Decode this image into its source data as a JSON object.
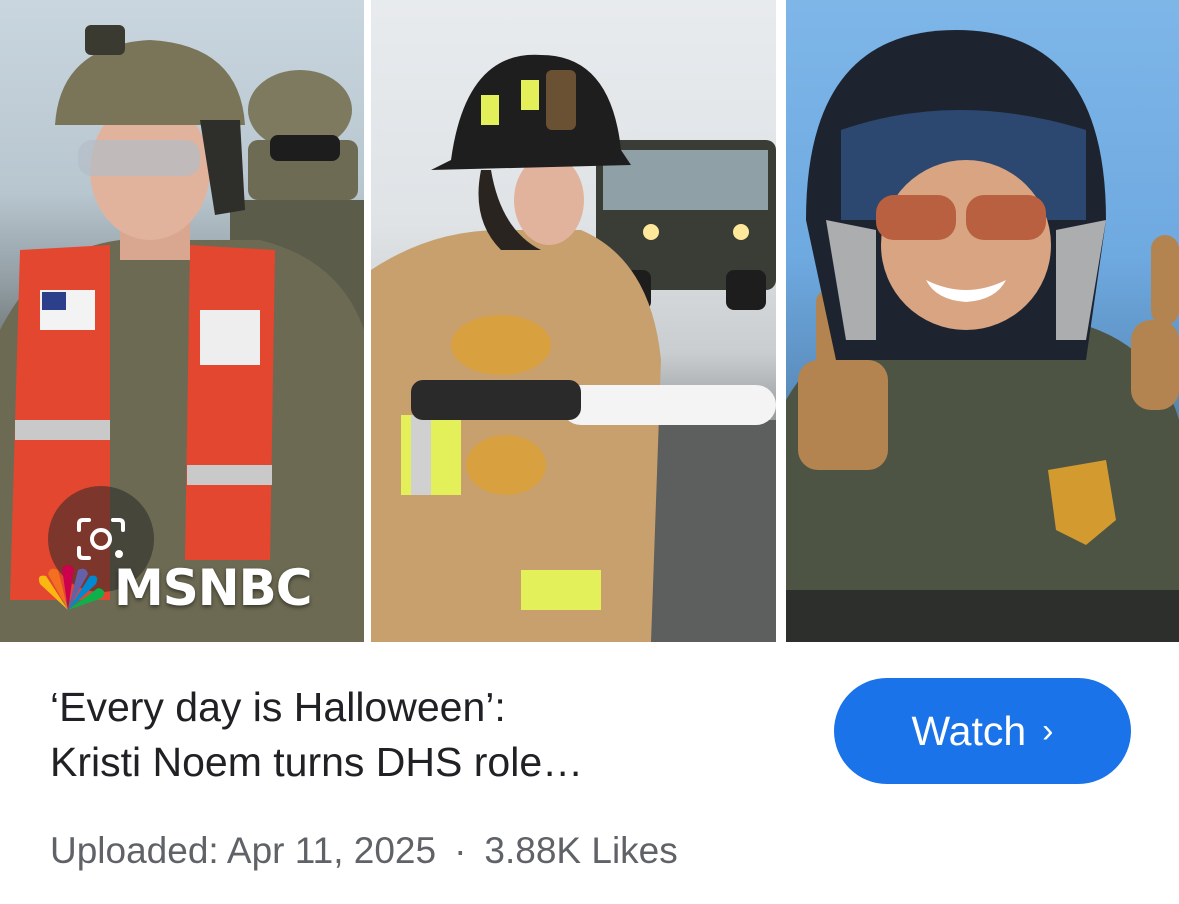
{
  "thumbnail": {
    "logo_text": "MSNBC",
    "lens_icon": "google-lens-icon",
    "panels": [
      "coast-guard-photo",
      "firefighter-photo",
      "border-patrol-motorcycle-photo"
    ]
  },
  "video": {
    "title_line1": "‘Every day is Halloween’:",
    "title_line2": "Kristi Noem turns DHS role…",
    "uploaded": "Uploaded: Apr 11, 2025",
    "separator": "·",
    "likes": "3.88K Likes"
  },
  "actions": {
    "watch_label": "Watch",
    "watch_chevron": "›"
  },
  "colors": {
    "accent": "#1a73e8",
    "title": "#202124",
    "meta": "#5f6368"
  }
}
